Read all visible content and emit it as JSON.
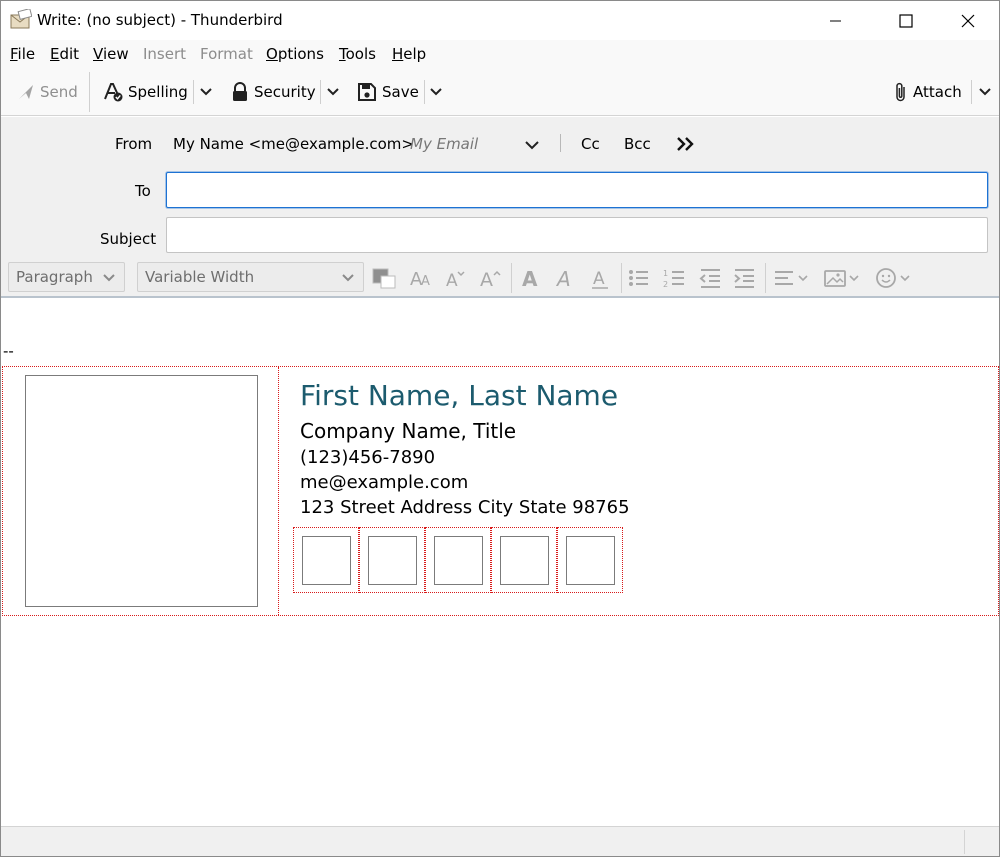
{
  "window": {
    "title": "Write: (no subject) - Thunderbird",
    "icon": "compose-icon"
  },
  "menubar": {
    "items": [
      {
        "label": "File",
        "enabled": true
      },
      {
        "label": "Edit",
        "enabled": true
      },
      {
        "label": "View",
        "enabled": true
      },
      {
        "label": "Insert",
        "enabled": false
      },
      {
        "label": "Format",
        "enabled": false
      },
      {
        "label": "Options",
        "enabled": true
      },
      {
        "label": "Tools",
        "enabled": true
      },
      {
        "label": "Help",
        "enabled": true
      }
    ]
  },
  "toolbar": {
    "send_label": "Send",
    "spelling_label": "Spelling",
    "security_label": "Security",
    "save_label": "Save",
    "attach_label": "Attach"
  },
  "headers": {
    "from_label": "From",
    "from_value": "My Name <me@example.com>",
    "from_identity": "My Email",
    "cc_label": "Cc",
    "bcc_label": "Bcc",
    "to_label": "To",
    "to_value": "",
    "subject_label": "Subject",
    "subject_value": ""
  },
  "format": {
    "paragraph_value": "Paragraph",
    "font_value": "Variable Width"
  },
  "signature": {
    "separator": "--",
    "name": "First Name, Last Name",
    "company": "Company Name, Title",
    "phone": "(123)456-7890",
    "email": "me@example.com",
    "address": "123 Street Address City State 98765",
    "name_color": "#1c5b6e",
    "social_count": 5
  },
  "colors": {
    "focus_border": "#1d72d3",
    "guide_border": "#d81b1b"
  }
}
